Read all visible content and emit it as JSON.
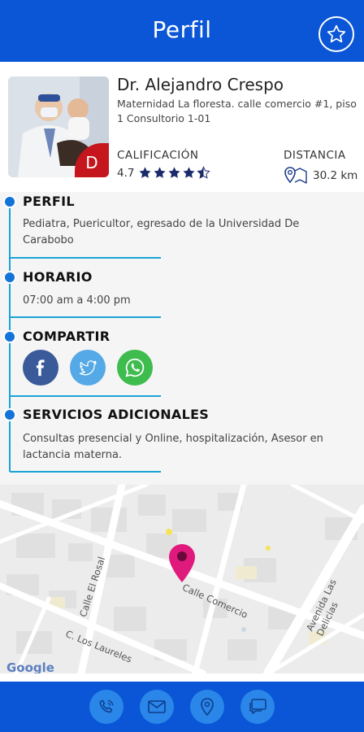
{
  "header": {
    "title": "Perfil",
    "favorite_icon": "star-icon"
  },
  "doctor": {
    "name": "Dr. Alejandro Crespo",
    "address": "Maternidad La floresta. calle comercio #1, piso 1 Consultorio 1-01",
    "badge_letter": "D",
    "rating_label": "CALIFICACIÓN",
    "rating_value": "4.7",
    "rating_stars": 4.5,
    "distance_label": "DISTANCIA",
    "distance_value": "30.2 km"
  },
  "sections": {
    "perfil": {
      "title": "PERFIL",
      "text": "Pediatra, Puericultor, egresado de la Universidad De Carabobo"
    },
    "horario": {
      "title": "HORARIO",
      "text": "07:00 am a 4:00 pm"
    },
    "compartir": {
      "title": "COMPARTIR",
      "networks": [
        "facebook-icon",
        "twitter-icon",
        "whatsapp-icon"
      ]
    },
    "servicios": {
      "title": "SERVICIOS ADICIONALES",
      "text": "Consultas presencial y Online, hospitalización, Asesor en lactancia materna."
    }
  },
  "map": {
    "streets": [
      "Calle Comercio",
      "Calle El Rosal",
      "C. Los Laureles",
      "Avenida Las Delicias"
    ],
    "attribution": "Google",
    "pin_color": "#e0197d"
  },
  "bottom_actions": [
    "phone-icon",
    "mail-icon",
    "location-icon",
    "chat-icon"
  ],
  "colors": {
    "primary": "#0a56d6",
    "timeline": "#1aa3d7",
    "badge": "#c4161c",
    "star": "#1b2a6b"
  }
}
